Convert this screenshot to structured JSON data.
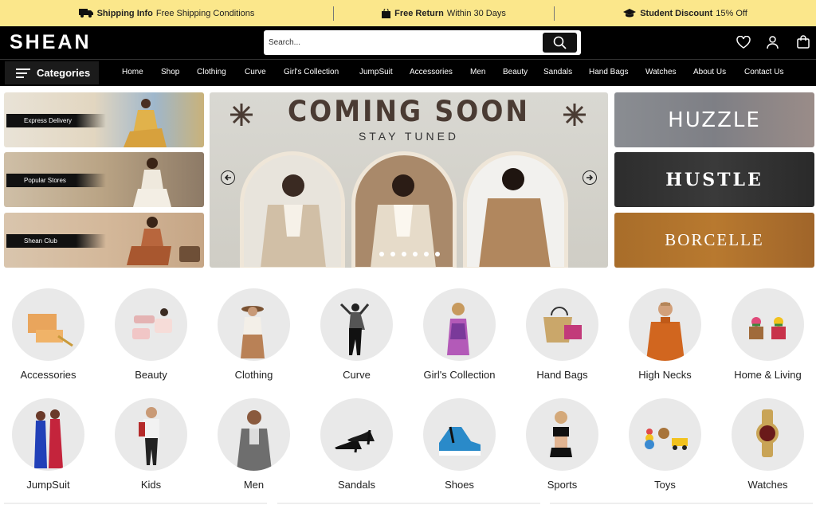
{
  "topbar": {
    "items": [
      {
        "title": "Shipping Info",
        "text": "Free Shipping Conditions"
      },
      {
        "title": "Free Return",
        "text": "Within 30 Days"
      },
      {
        "title": "Student Discount",
        "text": "15% Off"
      }
    ]
  },
  "header": {
    "logo": "SHEAN",
    "search_placeholder": "Search..."
  },
  "nav": {
    "categories_label": "Categories",
    "links": [
      "Home",
      "Shop",
      "Clothing",
      "Curve",
      "Girl's Collection",
      "JumpSuit",
      "Accessories",
      "Men",
      "Beauty",
      "Sandals",
      "Hand Bags",
      "Watches",
      "About Us",
      "Contact Us"
    ]
  },
  "promos": [
    "Express Delivery",
    "Popular Stores",
    "Shean Club"
  ],
  "hero": {
    "title": "COMING SOON",
    "subtitle": "STAY TUNED",
    "dots": 6
  },
  "brands": [
    "HUZZLE",
    "HUSTLE",
    "BORCELLE"
  ],
  "categories_row1": [
    "Accessories",
    "Beauty",
    "Clothing",
    "Curve",
    "Girl's Collection",
    "Hand Bags",
    "High Necks",
    "Home & Living"
  ],
  "categories_row2": [
    "JumpSuit",
    "Kids",
    "Men",
    "Sandals",
    "Shoes",
    "Sports",
    "Toys",
    "Watches"
  ],
  "colors": {
    "topbar_bg": "#fbe78b",
    "header_bg": "#000000",
    "circle_bg": "#e9e9e9"
  }
}
